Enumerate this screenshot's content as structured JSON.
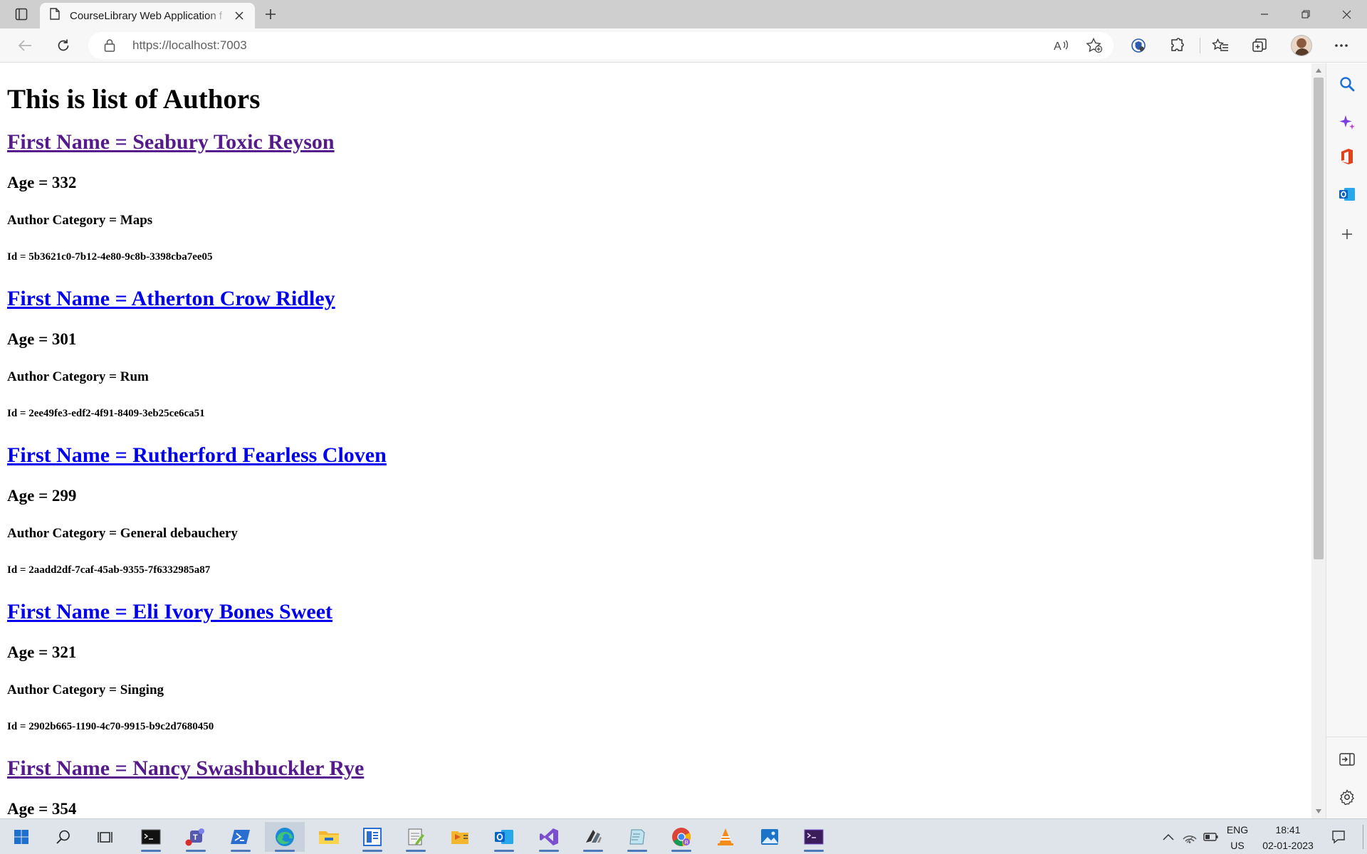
{
  "browser": {
    "tab_title": "CourseLibrary Web Application f",
    "url": "https://localhost:7003"
  },
  "page": {
    "title": "This is list of Authors",
    "authors": [
      {
        "name": "First Name = Seabury Toxic Reyson",
        "age": "Age = 332",
        "category": "Author Category = Maps",
        "id": "Id = 5b3621c0-7b12-4e80-9c8b-3398cba7ee05",
        "visited": true
      },
      {
        "name": "First Name = Atherton Crow Ridley",
        "age": "Age = 301",
        "category": "Author Category = Rum",
        "id": "Id = 2ee49fe3-edf2-4f91-8409-3eb25ce6ca51",
        "visited": false
      },
      {
        "name": "First Name = Rutherford Fearless Cloven",
        "age": "Age = 299",
        "category": "Author Category = General debauchery",
        "id": "Id = 2aadd2df-7caf-45ab-9355-7f6332985a87",
        "visited": false
      },
      {
        "name": "First Name = Eli Ivory Bones Sweet",
        "age": "Age = 321",
        "category": "Author Category = Singing",
        "id": "Id = 2902b665-1190-4c70-9915-b9c2d7680450",
        "visited": false
      },
      {
        "name": "First Name = Nancy Swashbuckler Rye",
        "age": "Age = 354",
        "visited": true
      }
    ]
  },
  "taskbar": {
    "lang_top": "ENG",
    "lang_bottom": "US",
    "time": "18:41",
    "date": "02-01-2023"
  },
  "colors": {
    "link_visited": "#551a8b",
    "link_unvisited": "#0000ee",
    "edge_blue": "#1e6fd9"
  }
}
